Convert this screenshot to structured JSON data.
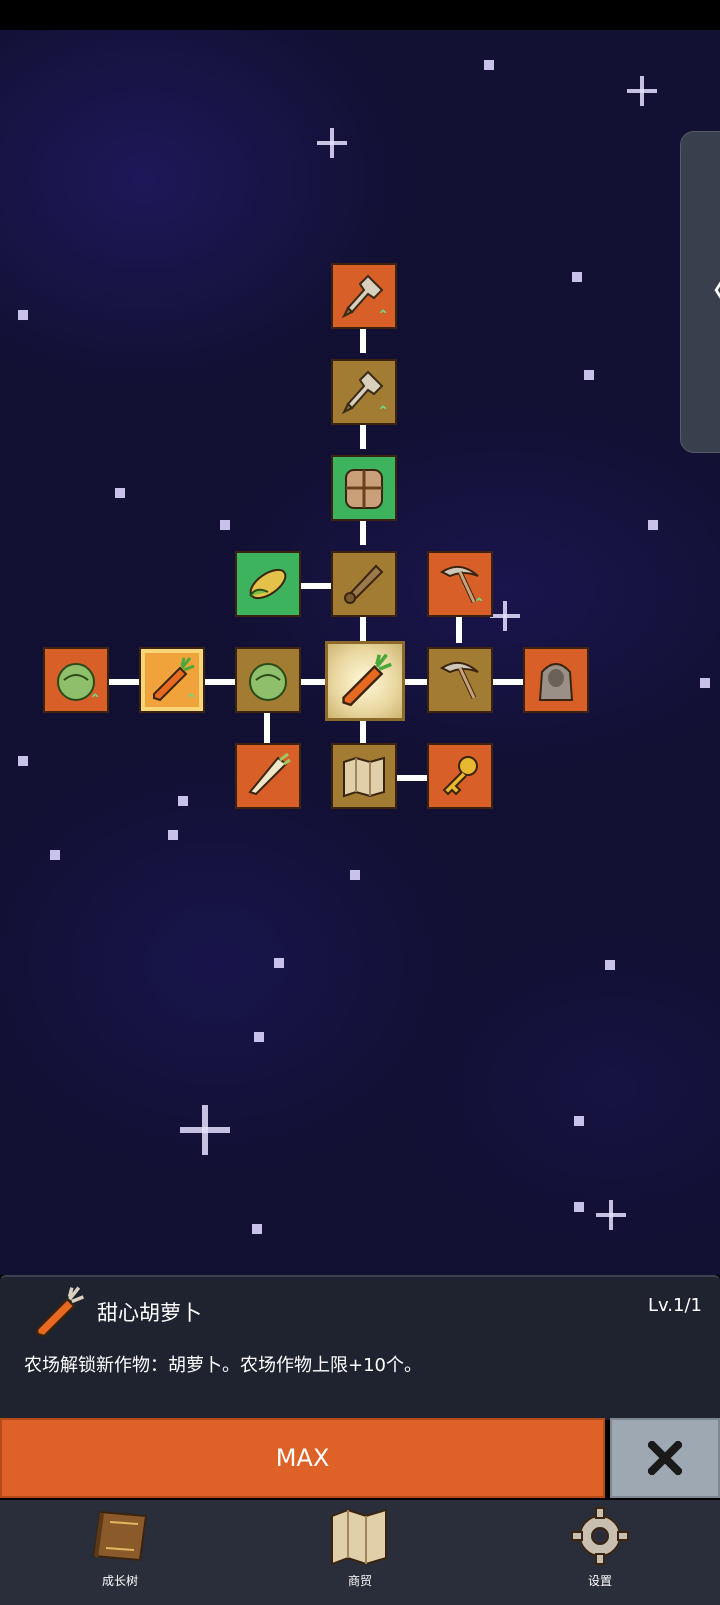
{
  "side_tab": {
    "arrow": "〈"
  },
  "tree": {
    "nodes": [
      {
        "id": "shovel-upgrade-2",
        "icon": "shovel-icon",
        "style": "orange"
      },
      {
        "id": "shovel-upgrade-1",
        "icon": "shovel-icon",
        "style": "gold"
      },
      {
        "id": "backpack",
        "icon": "backpack-icon",
        "style": "green"
      },
      {
        "id": "corn",
        "icon": "corn-icon",
        "style": "green"
      },
      {
        "id": "pestle",
        "icon": "pestle-icon",
        "style": "gold"
      },
      {
        "id": "pickaxe-upgrade",
        "icon": "pickaxe-icon",
        "style": "orange"
      },
      {
        "id": "cabbage-upgrade",
        "icon": "cabbage-icon",
        "style": "orange"
      },
      {
        "id": "carrot-upgrade",
        "icon": "carrot-icon",
        "style": "highlight"
      },
      {
        "id": "cabbage",
        "icon": "cabbage-icon",
        "style": "gold"
      },
      {
        "id": "sweet-carrot",
        "icon": "carrot-icon",
        "style": "center",
        "selected": true
      },
      {
        "id": "pickaxe",
        "icon": "pickaxe-icon",
        "style": "gold"
      },
      {
        "id": "hooded-statue",
        "icon": "hooded-figure-icon",
        "style": "orange"
      },
      {
        "id": "leek",
        "icon": "leek-icon",
        "style": "orange"
      },
      {
        "id": "map",
        "icon": "map-icon",
        "style": "gold"
      },
      {
        "id": "key",
        "icon": "key-icon",
        "style": "orange"
      }
    ]
  },
  "selected": {
    "icon": "carrot-icon",
    "title": "甜心胡萝卜",
    "level": "Lv.1/1",
    "description": "农场解锁新作物：胡萝卜。农场作物上限+10个。"
  },
  "actions": {
    "max_label": "MAX",
    "close_icon": "close-icon"
  },
  "bottom_nav": [
    {
      "label": "成长树",
      "icon": "book-icon"
    },
    {
      "label": "商贸",
      "icon": "map-icon"
    },
    {
      "label": "设置",
      "icon": "gear-icon"
    }
  ],
  "colors": {
    "accent": "#de6127",
    "background": "#121033",
    "panel": "#1f2330",
    "nav": "#2a2e3a"
  }
}
